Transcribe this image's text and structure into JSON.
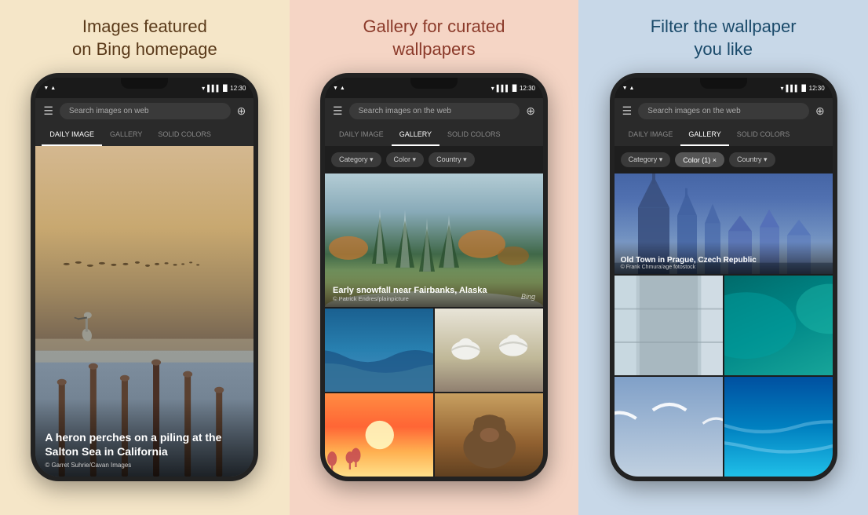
{
  "panels": [
    {
      "id": "panel-1",
      "title": "Images featured\non Bing homepage",
      "bg": "#f5e6c8",
      "titleColor": "#5a3a1a",
      "phone": {
        "time": "12:30",
        "searchPlaceholder": "Search images on web",
        "tabs": [
          {
            "label": "DAILY IMAGE",
            "active": true
          },
          {
            "label": "GALLERY",
            "active": false
          },
          {
            "label": "SOLID COLORS",
            "active": false
          }
        ],
        "dailyImage": {
          "title": "A heron perches on a piling at the Salton Sea in California",
          "credit": "© Garret Suhrie/Cavan Images"
        }
      }
    },
    {
      "id": "panel-2",
      "title": "Gallery for curated\nwallpapers",
      "bg": "#f5d5c5",
      "titleColor": "#8b3a2a",
      "phone": {
        "time": "12:30",
        "searchPlaceholder": "Search images on the web",
        "tabs": [
          {
            "label": "DAILY IMAGE",
            "active": false
          },
          {
            "label": "GALLERY",
            "active": true
          },
          {
            "label": "SOLID COLORS",
            "active": false
          }
        ],
        "filters": [
          {
            "label": "Category ▾"
          },
          {
            "label": "Color ▾"
          },
          {
            "label": "Country ▾"
          }
        ],
        "galleryMain": {
          "title": "Early snowfall near Fairbanks, Alaska",
          "credit": "© Patrick Endres/plainpicture"
        }
      }
    },
    {
      "id": "panel-3",
      "title": "Filter the wallpaper\nyou like",
      "bg": "#c8d8e8",
      "titleColor": "#1a4a6a",
      "phone": {
        "time": "12:30",
        "searchPlaceholder": "Search images on the web",
        "tabs": [
          {
            "label": "DAILY IMAGE",
            "active": false
          },
          {
            "label": "GALLERY",
            "active": true
          },
          {
            "label": "SOLID COLORS",
            "active": false
          }
        ],
        "filters": [
          {
            "label": "Category ▾"
          },
          {
            "label": "Color (1) ×",
            "active": true
          },
          {
            "label": "Country ▾"
          }
        ],
        "galleryMain": {
          "title": "Old Town in Prague, Czech Republic",
          "credit": "© Frank Chmura/age fotostock"
        }
      }
    }
  ],
  "icons": {
    "hamburger": "☰",
    "search": "🔍",
    "copyright": "©",
    "bing": "Bing"
  }
}
